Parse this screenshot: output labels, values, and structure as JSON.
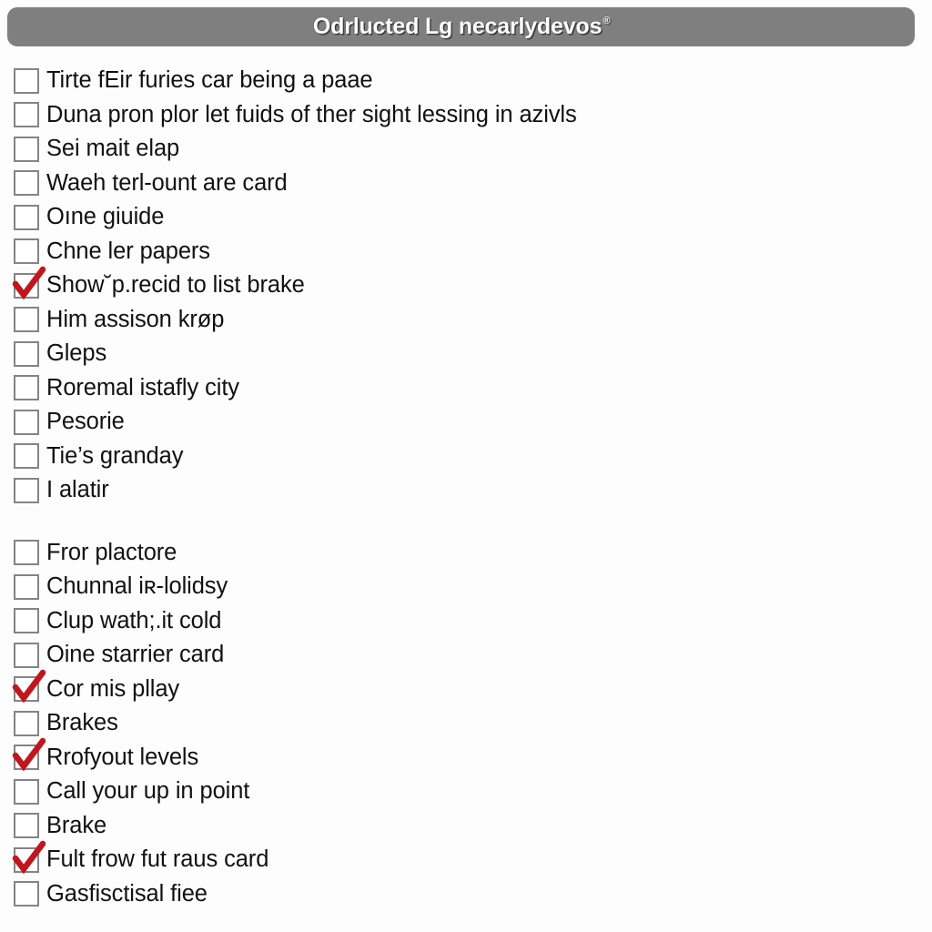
{
  "header": {
    "title": "Odrlucted Lg necarlydevos",
    "trademark_symbol": "®",
    "background_color": "#7f7f7f",
    "text_color": "#ffffff"
  },
  "theme": {
    "page_background": "#fdfdfe",
    "checkbox_border_color": "#848484",
    "checkbox_fill_color": "#ffffff",
    "checkmark_color": "#c0171f",
    "label_color": "#111111"
  },
  "checklist": {
    "groups": [
      {
        "items": [
          {
            "label": "Tirte fEir furies car being a paae",
            "checked": false
          },
          {
            "label": "Duna pron plor let fuids of ther sight lessing in azivls",
            "checked": false
          },
          {
            "label": "Sei mait elap",
            "checked": false
          },
          {
            "label": "Waeh terl-ount are card",
            "checked": false
          },
          {
            "label": "Oıne giuide",
            "checked": false
          },
          {
            "label": "Chne ler papers",
            "checked": false
          },
          {
            "label": "Show˘p.recid to list brake",
            "checked": true
          },
          {
            "label": "Him assison krøp",
            "checked": false
          },
          {
            "label": "Gleps",
            "checked": false
          },
          {
            "label": "Roremal istafly city",
            "checked": false
          },
          {
            "label": "Pesorie",
            "checked": false
          },
          {
            "label": "Tie’s granday",
            "checked": false
          },
          {
            "label": "I alatir",
            "checked": false
          }
        ]
      },
      {
        "items": [
          {
            "label": "Fror plactore",
            "checked": false
          },
          {
            "label": "Chunnal iʀ-lolidsy",
            "checked": false
          },
          {
            "label": "Clup wath;.it cold",
            "checked": false
          },
          {
            "label": "Oine starrier card",
            "checked": false
          },
          {
            "label": "Cor mis pllay",
            "checked": true
          },
          {
            "label": "Brakes",
            "checked": false
          },
          {
            "label": "Rrofyout levels",
            "checked": true
          },
          {
            "label": "Call your up in point",
            "checked": false
          },
          {
            "label": "Brake",
            "checked": false
          },
          {
            "label": "Fult frow fut raus card",
            "checked": true
          },
          {
            "label": "Gasfisctisal fiee",
            "checked": false
          }
        ]
      }
    ]
  }
}
